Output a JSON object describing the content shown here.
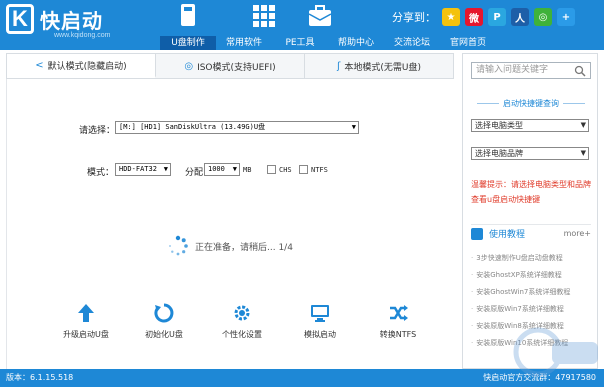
{
  "header": {
    "logo_letter": "K",
    "logo_text": "快启动",
    "logo_url": "www.kqidong.com",
    "nav": [
      {
        "label": "U盘制作",
        "icon": "usb-icon",
        "active": true
      },
      {
        "label": "常用软件",
        "icon": "grid-apps-icon",
        "active": false
      },
      {
        "label": "PE工具",
        "icon": "briefcase-icon",
        "active": false
      },
      {
        "label": "帮助中心",
        "icon": "help-icon",
        "active": false
      },
      {
        "label": "交流论坛",
        "icon": "forum-icon",
        "active": false
      },
      {
        "label": "官网首页",
        "icon": "home-icon",
        "active": false
      }
    ],
    "share_label": "分享到：",
    "share_icons": [
      {
        "name": "qzone-icon",
        "color": "#f4c20d"
      },
      {
        "name": "weibo-icon",
        "color": "#e6162d"
      },
      {
        "name": "tencent-weibo-icon",
        "color": "#2aa7e0"
      },
      {
        "name": "renren-icon",
        "color": "#1d5fa8"
      },
      {
        "name": "wechat-icon",
        "color": "#3fb23a"
      },
      {
        "name": "plus-icon",
        "color": "#2b9be8"
      }
    ]
  },
  "tabs": [
    {
      "label": "默认模式(隐藏启动)",
      "icon": "share-node-icon",
      "active": true
    },
    {
      "label": "ISO模式(支持UEFI)",
      "icon": "disc-icon",
      "active": false
    },
    {
      "label": "本地模式(无需U盘)",
      "icon": "rss-icon",
      "active": false
    }
  ],
  "main": {
    "select_label": "请选择：",
    "device_value": "[M:] [HD1] SanDiskUltra (13.49G)U盘",
    "mode_label": "模式：",
    "mode_value": "HDD-FAT32",
    "alloc_label": "分配",
    "alloc_value": "1000",
    "alloc_unit": "MB",
    "chs_label": "CHS",
    "ntfs_label": "NTFS",
    "status_text": "正在准备，请稍后... 1/4"
  },
  "toolbar": [
    {
      "label": "升级启动U盘",
      "icon": "upgrade-arrow-icon"
    },
    {
      "label": "初始化U盘",
      "icon": "init-usb-icon"
    },
    {
      "label": "个性化设置",
      "icon": "gear-icon"
    },
    {
      "label": "模拟启动",
      "icon": "monitor-icon"
    },
    {
      "label": "转换NTFS",
      "icon": "convert-shuffle-icon"
    }
  ],
  "sidebar": {
    "search_placeholder": "请输入问题关键字",
    "shortcut_title": "启动快捷键查询",
    "computer_type": "选择电脑类型",
    "computer_brand": "选择电脑品牌",
    "warm_tip": "温馨提示：请选择电脑类型和品牌查看u盘启动快捷键",
    "tutorial_title": "使用教程",
    "more_label": "more+",
    "tutorials": [
      "3步快速制作U盘启动盘教程",
      "安装GhostXP系统详细教程",
      "安装GhostWin7系统详细教程",
      "安装原版Win7系统详细教程",
      "安装原版Win8系统详细教程",
      "安装原版Win10系统详细教程"
    ]
  },
  "footer": {
    "version": "版本：6.1.15.518",
    "qq_group": "快启动官方交流群：47917580"
  },
  "colors": {
    "brand_blue": "#1e88d6",
    "nav_active": "#0f5ea8",
    "warning_red": "#e03b2a"
  }
}
